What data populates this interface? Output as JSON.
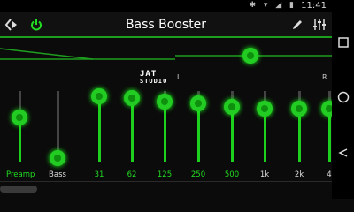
{
  "status": {
    "time": "11:41"
  },
  "toolbar": {
    "title": "Bass Booster",
    "nav_icon": "chevron-left-right-icon",
    "power_icon": "power-icon",
    "edit_icon": "pencil-icon",
    "settings_icon": "sliders-icon"
  },
  "logo": {
    "line1": "JAT",
    "line2": "STUDIO"
  },
  "channels": {
    "left": "L",
    "right": "R"
  },
  "balance": {
    "value_percent": 63
  },
  "equalizer": {
    "bands": [
      {
        "label": "Preamp",
        "level": 0.62,
        "color": "#22dd22"
      },
      {
        "label": "Bass",
        "level": 0.05,
        "color": "#dddddd"
      },
      {
        "label": "31",
        "level": 0.92,
        "color": "#22dd22"
      },
      {
        "label": "62",
        "level": 0.9,
        "color": "#22dd22"
      },
      {
        "label": "125",
        "level": 0.85,
        "color": "#22dd22"
      },
      {
        "label": "250",
        "level": 0.82,
        "color": "#22dd22"
      },
      {
        "label": "500",
        "level": 0.78,
        "color": "#22dd22"
      },
      {
        "label": "1k",
        "level": 0.75,
        "color": "#dddddd"
      },
      {
        "label": "2k",
        "level": 0.75,
        "color": "#dddddd"
      },
      {
        "label": "4",
        "level": 0.75,
        "color": "#dddddd"
      }
    ]
  },
  "colors": {
    "accent": "#22cc22",
    "background": "#0b0b0b"
  },
  "navbar": {
    "recents_icon": "recents-icon",
    "home_icon": "home-icon",
    "back_icon": "back-icon"
  }
}
